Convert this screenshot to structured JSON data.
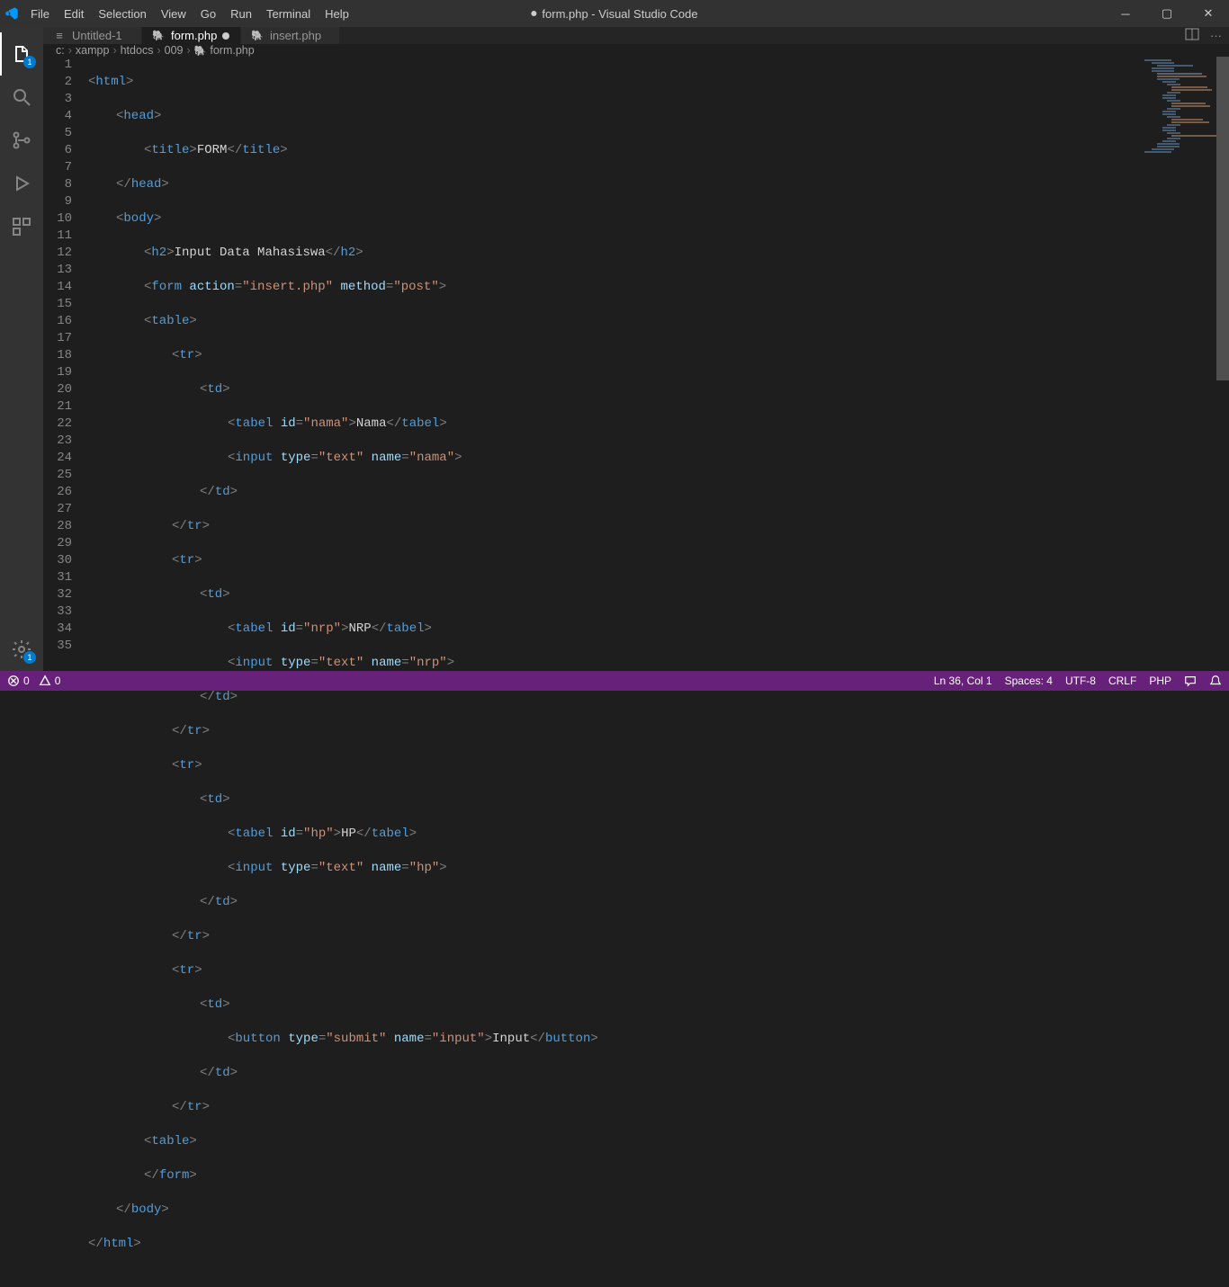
{
  "title": "form.php - Visual Studio Code",
  "menu": [
    "File",
    "Edit",
    "Selection",
    "View",
    "Go",
    "Run",
    "Terminal",
    "Help"
  ],
  "tabs": [
    {
      "label": "Untitled-1",
      "icon": "file",
      "active": false,
      "dirty": false
    },
    {
      "label": "form.php",
      "icon": "php",
      "active": true,
      "dirty": true
    },
    {
      "label": "insert.php",
      "icon": "php",
      "active": false,
      "dirty": false
    }
  ],
  "breadcrumbs": [
    "c:",
    "xampp",
    "htdocs",
    "009",
    "form.php"
  ],
  "activity": {
    "explorer_badge": "1",
    "settings_badge": "1"
  },
  "status": {
    "errors": "0",
    "warnings": "0",
    "ln_col": "Ln 36, Col 1",
    "spaces": "Spaces: 4",
    "encoding": "UTF-8",
    "eol": "CRLF",
    "lang": "PHP"
  },
  "code": {
    "l1": {
      "tag": "html"
    },
    "l2": {
      "tag": "head"
    },
    "l3": {
      "tag": "title",
      "text": "FORM"
    },
    "l4": {
      "tag": "head"
    },
    "l5": {
      "tag": "body"
    },
    "l6": {
      "tag": "h2",
      "text": "Input Data Mahasiswa"
    },
    "l7": {
      "tag": "form",
      "a1": "action",
      "v1": "\"insert.php\"",
      "a2": "method",
      "v2": "\"post\""
    },
    "l8": {
      "tag": "table"
    },
    "l9": {
      "tag": "tr"
    },
    "l10": {
      "tag": "td"
    },
    "l11": {
      "tag": "tabel",
      "a1": "id",
      "v1": "\"nama\"",
      "text": "Nama"
    },
    "l12": {
      "tag": "input",
      "a1": "type",
      "v1": "\"text\"",
      "a2": "name",
      "v2": "\"nama\""
    },
    "l13": {
      "tag": "td"
    },
    "l14": {
      "tag": "tr"
    },
    "l15": {
      "tag": "tr"
    },
    "l16": {
      "tag": "td"
    },
    "l17": {
      "tag": "tabel",
      "a1": "id",
      "v1": "\"nrp\"",
      "text": "NRP"
    },
    "l18": {
      "tag": "input",
      "a1": "type",
      "v1": "\"text\"",
      "a2": "name",
      "v2": "\"nrp\""
    },
    "l19": {
      "tag": "td"
    },
    "l20": {
      "tag": "tr"
    },
    "l21": {
      "tag": "tr"
    },
    "l22": {
      "tag": "td"
    },
    "l23": {
      "tag": "tabel",
      "a1": "id",
      "v1": "\"hp\"",
      "text": "HP"
    },
    "l24": {
      "tag": "input",
      "a1": "type",
      "v1": "\"text\"",
      "a2": "name",
      "v2": "\"hp\""
    },
    "l25": {
      "tag": "td"
    },
    "l26": {
      "tag": "tr"
    },
    "l27": {
      "tag": "tr"
    },
    "l28": {
      "tag": "td"
    },
    "l29": {
      "tag": "button",
      "a1": "type",
      "v1": "\"submit\"",
      "a2": "name",
      "v2": "\"input\"",
      "text": "Input"
    },
    "l30": {
      "tag": "td"
    },
    "l31": {
      "tag": "tr"
    },
    "l32": {
      "tag": "table"
    },
    "l33": {
      "tag": "form"
    },
    "l34": {
      "tag": "body"
    },
    "l35": {
      "tag": "html"
    }
  }
}
